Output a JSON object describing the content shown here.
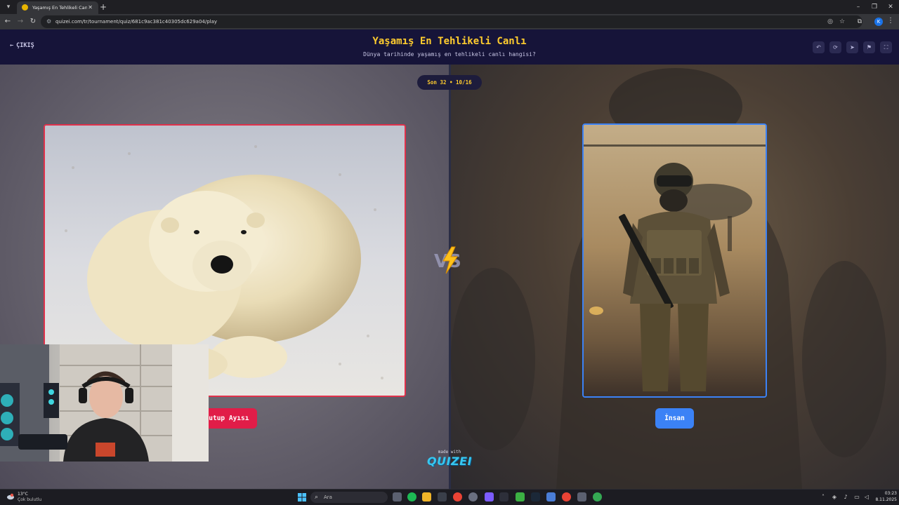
{
  "browser": {
    "tab_title": "Yaşamış En Tehlikeli Canlı - Tier",
    "url": "quizei.com/tr/tournament/quiz/681c9ac381c40305dc629a04/play",
    "profile_initial": "K"
  },
  "quiz": {
    "exit_label": "ÇIKIŞ",
    "title": "Yaşamış En Tehlikeli Canlı",
    "subtitle": "Dünya tarihinde yaşamış en tehlikeli canlı hangisi?",
    "round": "Son 32 • 10/16",
    "left_choice": "Kutup Ayısı",
    "right_choice": "İnsan",
    "made_with": "made with",
    "logo": "QUIZEI",
    "colors": {
      "left_accent": "#e11d48",
      "right_accent": "#3b82f6",
      "title": "#ffcc2e"
    }
  },
  "taskbar": {
    "weather_temp": "13°C",
    "weather_desc": "Çok bulutlu",
    "search_placeholder": "Ara",
    "time": "03:23",
    "date": "8.11.2025"
  }
}
